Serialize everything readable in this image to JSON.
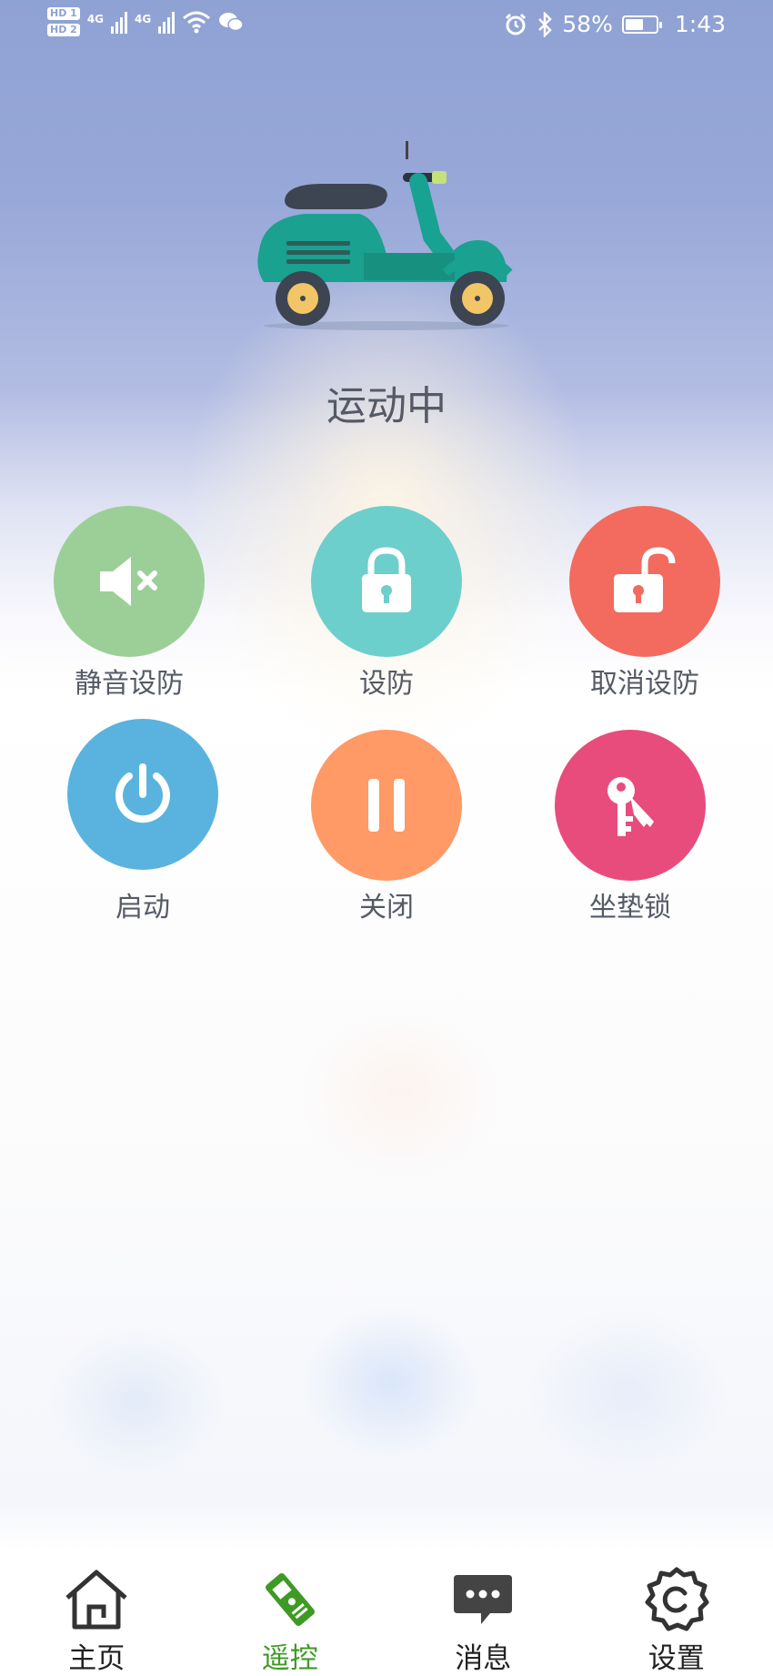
{
  "status_bar": {
    "battery_percent": "58%",
    "battery_level": 0.58,
    "time": "1:43",
    "network_1": "4G",
    "network_2": "4G",
    "hd_1": "HD 1",
    "hd_2": "HD 2"
  },
  "vehicle": {
    "image": "scooter-icon",
    "status": "运动中"
  },
  "controls": [
    {
      "label": "静音设防",
      "icon": "speaker-mute-icon",
      "color": "#9ccf97"
    },
    {
      "label": "设防",
      "icon": "lock-closed-icon",
      "color": "#6dcfcc"
    },
    {
      "label": "取消设防",
      "icon": "lock-open-icon",
      "color": "#f26b5e"
    },
    {
      "label": "启动",
      "icon": "power-icon",
      "color": "#5ab3de"
    },
    {
      "label": "关闭",
      "icon": "pause-icon",
      "color": "#ff9966"
    },
    {
      "label": "坐垫锁",
      "icon": "keys-icon",
      "color": "#e84c7d"
    }
  ],
  "tab_bar": {
    "items": [
      {
        "label": "主页",
        "icon": "home-icon",
        "active": false
      },
      {
        "label": "遥控",
        "icon": "remote-icon",
        "active": true
      },
      {
        "label": "消息",
        "icon": "message-icon",
        "active": false
      },
      {
        "label": "设置",
        "icon": "settings-icon",
        "active": false
      }
    ],
    "active_color": "#3f9a25"
  }
}
